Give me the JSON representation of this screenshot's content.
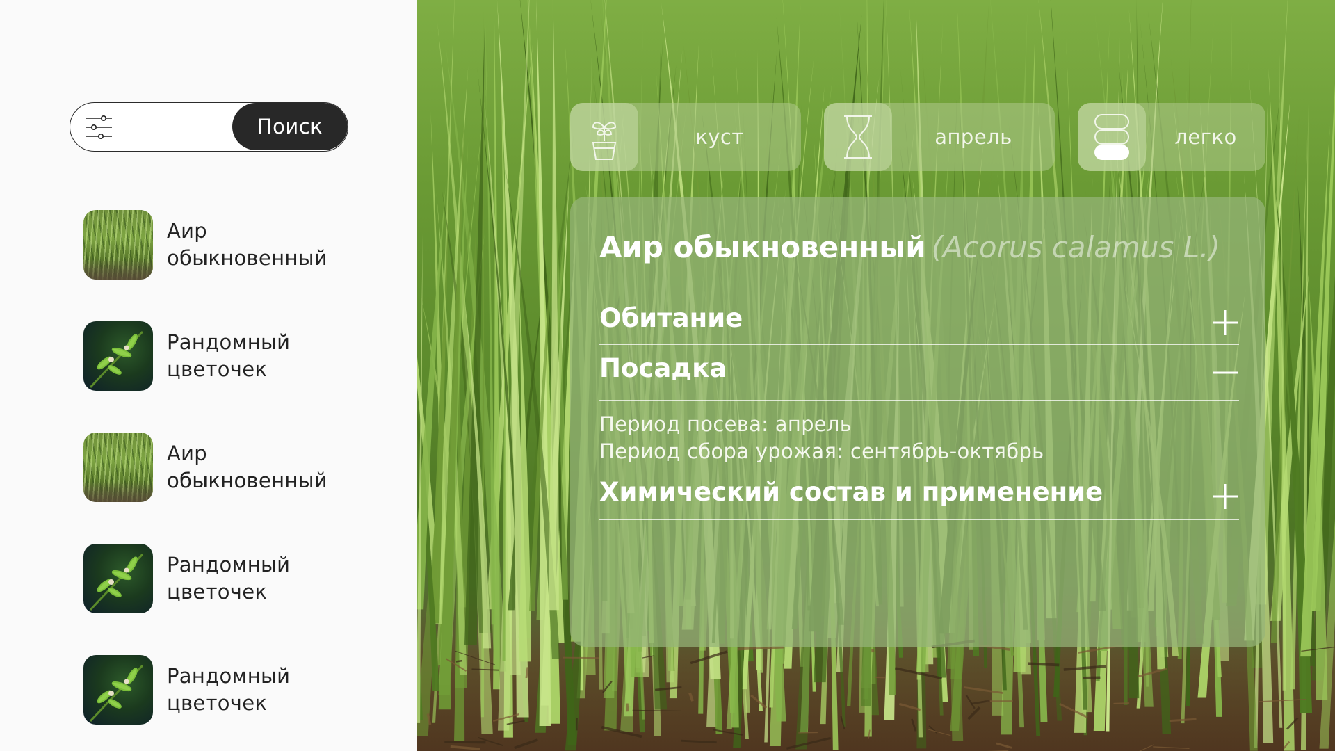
{
  "search": {
    "filter_icon": "sliders-icon",
    "button_label": "Поиск"
  },
  "plants": [
    {
      "name_line1": "Аир",
      "name_line2": "обыкновенный",
      "thumb": "grass"
    },
    {
      "name_line1": "Рандомный",
      "name_line2": "цветочек",
      "thumb": "flower"
    },
    {
      "name_line1": "Аир",
      "name_line2": "обыкновенный",
      "thumb": "grass"
    },
    {
      "name_line1": "Рандомный",
      "name_line2": "цветочек",
      "thumb": "flower"
    },
    {
      "name_line1": "Рандомный",
      "name_line2": "цветочек",
      "thumb": "flower"
    }
  ],
  "tags": {
    "type": {
      "icon": "potted-plant-icon",
      "label": "куст"
    },
    "month": {
      "icon": "hourglass-icon",
      "label": "апрель"
    },
    "difficulty": {
      "icon": "difficulty-level-icon",
      "label": "легко",
      "level_filled": 1,
      "level_total": 3
    }
  },
  "card": {
    "title": "Аир обыкновенный",
    "latin": "(Acorus calamus L.)",
    "sections": {
      "habitat": {
        "title": "Обитание",
        "state": "collapsed"
      },
      "planting": {
        "title": "Посадка",
        "state": "expanded"
      },
      "chemistry": {
        "title": "Химический состав и применение",
        "state": "collapsed"
      }
    },
    "planting_text": {
      "line1": "Период посева: апрель",
      "line2": "Период сбора урожая: сентябрь-октябрь"
    }
  },
  "colors": {
    "search_button_bg": "#282828",
    "card_bg": "rgba(150,180,120,0.72)",
    "text_dark": "#222222"
  }
}
